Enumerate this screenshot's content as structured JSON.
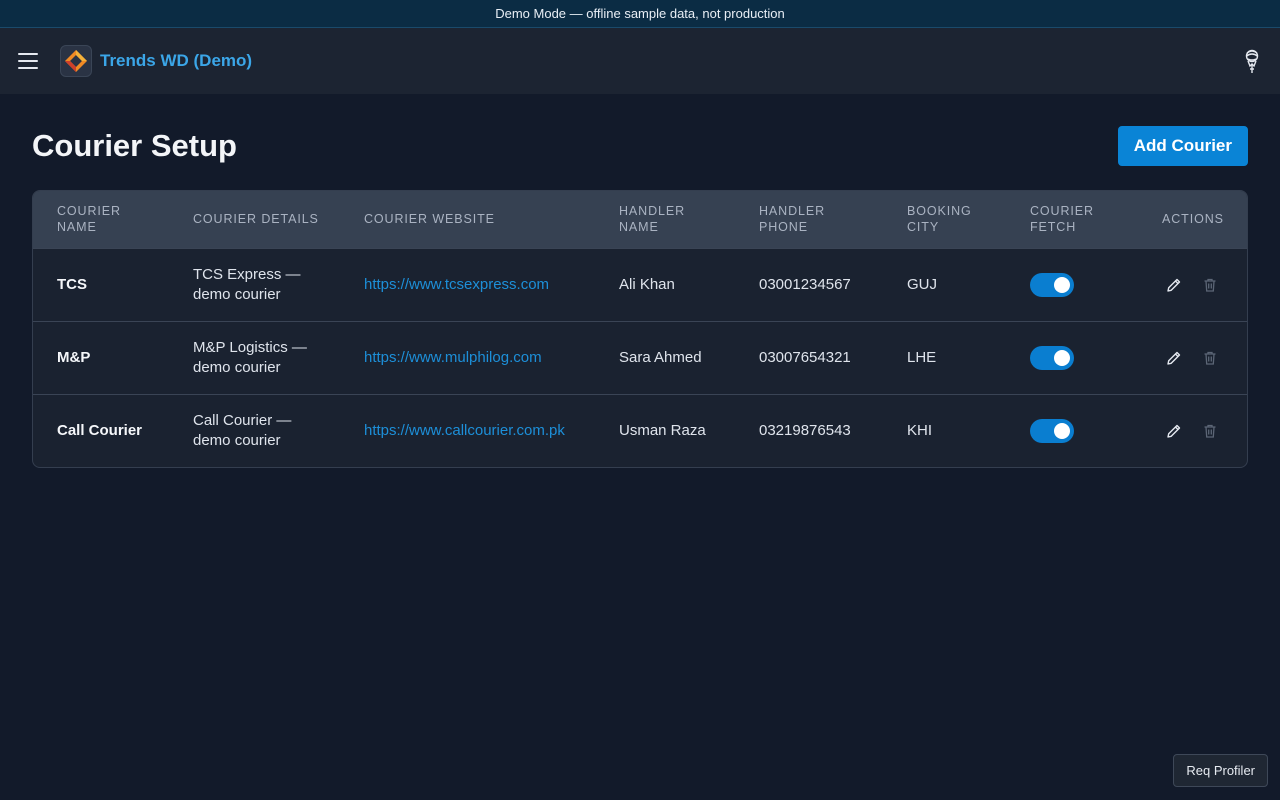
{
  "banner": {
    "text": "Demo Mode — offline sample data, not production"
  },
  "header": {
    "app_title": "Trends WD (Demo)",
    "menu_icon": "hamburger-menu-icon",
    "logo_icon": "brand-logo-icon",
    "user_icon": "user-avatar-icon"
  },
  "page": {
    "title": "Courier Setup",
    "add_button": "Add Courier"
  },
  "table": {
    "headers": {
      "courier_name": "Courier Name",
      "courier_details": "Courier Details",
      "courier_website": "Courier Website",
      "handler_name": "Handler Name",
      "handler_phone": "Handler Phone",
      "booking_city": "Booking City",
      "courier_fetch": "Courier Fetch",
      "actions": "Actions"
    },
    "rows": [
      {
        "name": "TCS",
        "details": "TCS Express — demo courier",
        "website": "https://www.tcsexpress.com",
        "handler_name": "Ali Khan",
        "handler_phone": "03001234567",
        "booking_city": "GUJ",
        "courier_fetch": true
      },
      {
        "name": "M&P",
        "details": "M&P Logistics — demo courier",
        "website": "https://www.mulphilog.com",
        "handler_name": "Sara Ahmed",
        "handler_phone": "03007654321",
        "booking_city": "LHE",
        "courier_fetch": true
      },
      {
        "name": "Call Courier",
        "details": "Call Courier — demo courier",
        "website": "https://www.callcourier.com.pk",
        "handler_name": "Usman Raza",
        "handler_phone": "03219876543",
        "booking_city": "KHI",
        "courier_fetch": true
      }
    ]
  },
  "profiler": {
    "label": "Req Profiler"
  },
  "colors": {
    "accent": "#0a84d6",
    "link": "#1d8fd8",
    "title_blue": "#3ba6e8",
    "background": "#121a2a"
  }
}
